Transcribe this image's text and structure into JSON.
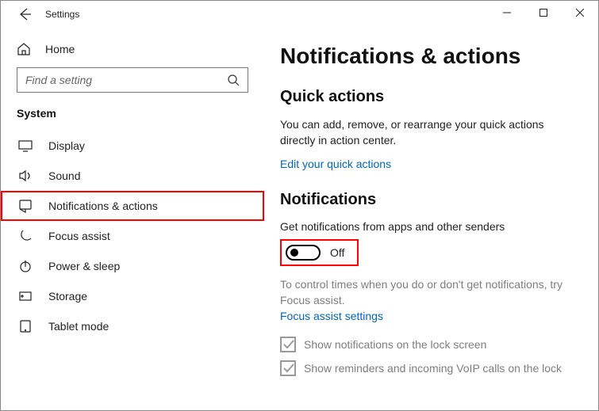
{
  "titlebar": {
    "title": "Settings"
  },
  "sidebar": {
    "home": "Home",
    "search_placeholder": "Find a setting",
    "heading": "System",
    "items": [
      {
        "label": "Display"
      },
      {
        "label": "Sound"
      },
      {
        "label": "Notifications & actions"
      },
      {
        "label": "Focus assist"
      },
      {
        "label": "Power & sleep"
      },
      {
        "label": "Storage"
      },
      {
        "label": "Tablet mode"
      }
    ]
  },
  "main": {
    "h1": "Notifications & actions",
    "quick_heading": "Quick actions",
    "quick_desc": "You can add, remove, or rearrange your quick actions directly in action center.",
    "quick_link": "Edit your quick actions",
    "notif_heading": "Notifications",
    "notif_desc": "Get notifications from apps and other senders",
    "toggle_state": "Off",
    "control_text": "To control times when you do or don't get notifications, try Focus assist.",
    "focus_link": "Focus assist settings",
    "chk1": "Show notifications on the lock screen",
    "chk2": "Show reminders and incoming VoIP calls on the lock"
  }
}
